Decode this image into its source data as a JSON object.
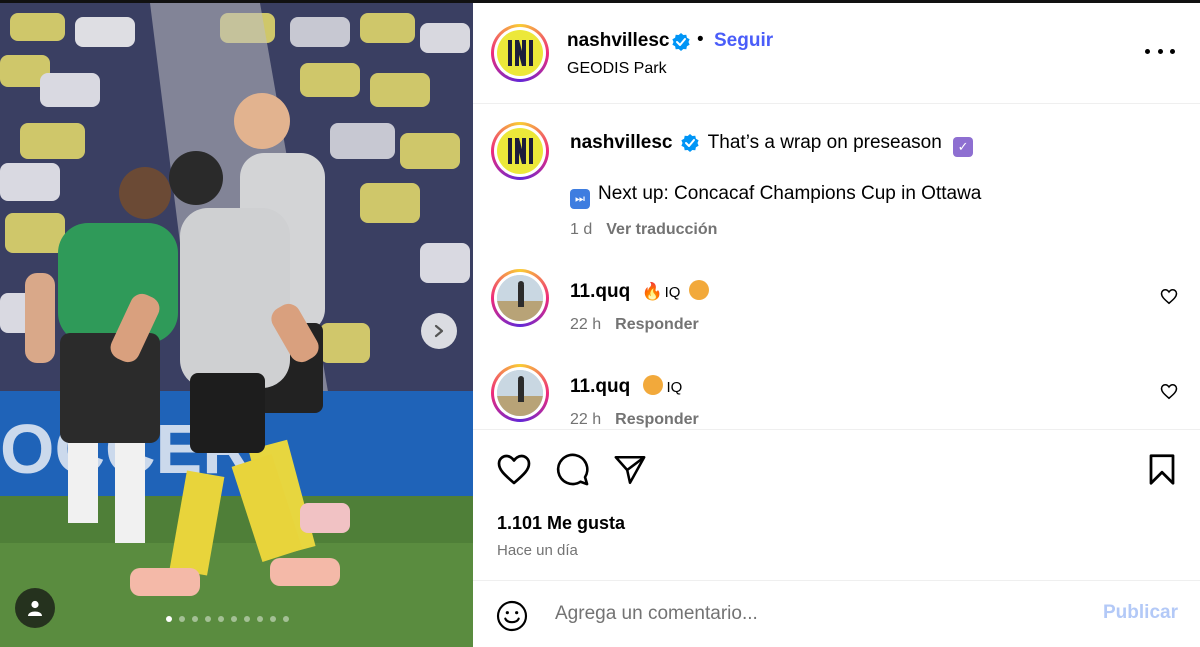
{
  "post": {
    "username": "nashvillesc",
    "separator": "•",
    "follow_label": "Seguir",
    "location": "GEODIS Park",
    "verified_color": "#0095f6",
    "accent_color": "#4a5df9"
  },
  "caption": {
    "username": "nashvillesc",
    "text": "That’s a wrap on preseason",
    "line2": "Next up: Concacaf Champions Cup in Ottawa",
    "emoji1": "check-box-emoji",
    "emoji2": "next-track-emoji",
    "age": "1 d",
    "translate_label": "Ver traducción"
  },
  "comments": [
    {
      "username": "11.quq",
      "text_a": "IQ",
      "age": "22 h",
      "reply_label": "Responder"
    },
    {
      "username": "11.quq",
      "text_a": "IQ",
      "age": "22 h",
      "reply_label": "Responder"
    }
  ],
  "stats": {
    "likes": "1.101 Me gusta",
    "posted": "Hace un día"
  },
  "compose": {
    "placeholder": "Agrega un comentario...",
    "post_label": "Publicar",
    "post_color": "#b3c9f7"
  },
  "carousel": {
    "slide_count": 10,
    "active_index": 0
  }
}
